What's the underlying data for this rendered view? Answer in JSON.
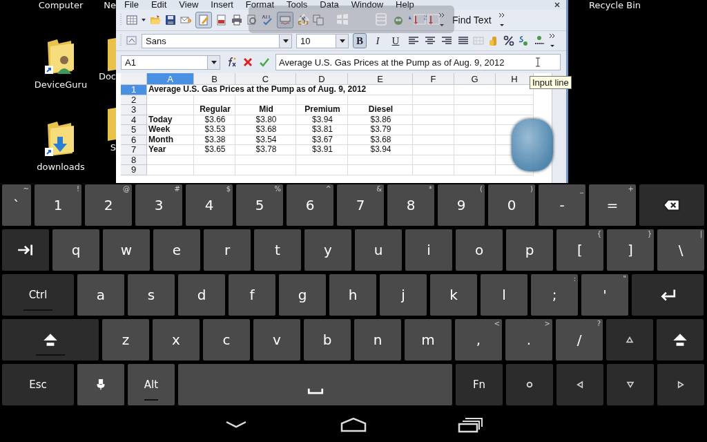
{
  "desktop": {
    "icons": [
      {
        "label": "Computer",
        "kind": "label"
      },
      {
        "label": "DeviceGuru",
        "kind": "folder"
      },
      {
        "label": "downloads",
        "kind": "folder"
      }
    ],
    "cut_icons": [
      {
        "label": "Ne",
        "kind": "label"
      },
      {
        "label": "Doc",
        "kind": "folder"
      },
      {
        "label": "S",
        "kind": "folder"
      }
    ],
    "recycle_bin": "Recycle Bin"
  },
  "spreadsheet": {
    "menu": [
      "File",
      "Edit",
      "View",
      "Insert",
      "Format",
      "Tools",
      "Data",
      "Window",
      "Help"
    ],
    "find_text": "Find Text",
    "font_name": "Sans",
    "font_size": "10",
    "format_buttons": [
      {
        "label": "B",
        "selected": true
      },
      {
        "label": "I",
        "selected": false
      },
      {
        "label": "U",
        "selected": false
      }
    ],
    "name_box": "A1",
    "input_line": "Average U.S. Gas Prices at the Pump as of Aug. 9, 2012",
    "tooltip": "Input line",
    "columns": [
      {
        "label": "A",
        "selected": true
      },
      {
        "label": "B",
        "selected": false
      },
      {
        "label": "C",
        "selected": false
      },
      {
        "label": "D",
        "selected": false
      },
      {
        "label": "E",
        "selected": false
      },
      {
        "label": "F",
        "selected": false
      },
      {
        "label": "G",
        "selected": false
      },
      {
        "label": "H",
        "selected": false
      }
    ],
    "rows": [
      {
        "number": "1",
        "selected": true,
        "kind": "title",
        "title": "Average U.S. Gas Prices at the Pump as of Aug. 9, 2012"
      },
      {
        "number": "2",
        "selected": false,
        "kind": "blank"
      },
      {
        "number": "3",
        "selected": false,
        "kind": "header",
        "values": [
          "Regular",
          "Mid",
          "Premium",
          "Diesel"
        ]
      },
      {
        "number": "4",
        "selected": false,
        "kind": "data",
        "label": "Today",
        "values": [
          "$3.66",
          "$3.80",
          "$3.94",
          "$3.86"
        ]
      },
      {
        "number": "5",
        "selected": false,
        "kind": "data",
        "label": "Week",
        "values": [
          "$3.53",
          "$3.68",
          "$3.81",
          "$3.79"
        ]
      },
      {
        "number": "6",
        "selected": false,
        "kind": "data",
        "label": "Month",
        "values": [
          "$3.38",
          "$3.54",
          "$3.67",
          "$3.68"
        ]
      },
      {
        "number": "7",
        "selected": false,
        "kind": "data",
        "label": "Year",
        "values": [
          "$3.65",
          "$3.78",
          "$3.91",
          "$3.94"
        ]
      },
      {
        "number": "8",
        "selected": false,
        "kind": "blank"
      },
      {
        "number": "9",
        "selected": false,
        "kind": "blank"
      }
    ]
  },
  "keyboard": {
    "rows": [
      {
        "keys": [
          {
            "kind": "char",
            "label": "`",
            "hint": "~"
          },
          {
            "kind": "char",
            "label": "1",
            "hint": "!"
          },
          {
            "kind": "char",
            "label": "2",
            "hint": "@"
          },
          {
            "kind": "char",
            "label": "3",
            "hint": "#"
          },
          {
            "kind": "char",
            "label": "4",
            "hint": "$"
          },
          {
            "kind": "char",
            "label": "5",
            "hint": "%"
          },
          {
            "kind": "char",
            "label": "6",
            "hint": "^"
          },
          {
            "kind": "char",
            "label": "7",
            "hint": "&"
          },
          {
            "kind": "char",
            "label": "8",
            "hint": "*"
          },
          {
            "kind": "char",
            "label": "9",
            "hint": "("
          },
          {
            "kind": "char",
            "label": "0",
            "hint": ")"
          },
          {
            "kind": "char",
            "label": "-",
            "hint": "_"
          },
          {
            "kind": "char",
            "label": "=",
            "hint": "+"
          },
          {
            "kind": "backspace"
          }
        ]
      },
      {
        "keys": [
          {
            "kind": "tab"
          },
          {
            "kind": "char",
            "label": "q"
          },
          {
            "kind": "char",
            "label": "w"
          },
          {
            "kind": "char",
            "label": "e"
          },
          {
            "kind": "char",
            "label": "r"
          },
          {
            "kind": "char",
            "label": "t"
          },
          {
            "kind": "char",
            "label": "y"
          },
          {
            "kind": "char",
            "label": "u"
          },
          {
            "kind": "char",
            "label": "i"
          },
          {
            "kind": "char",
            "label": "o"
          },
          {
            "kind": "char",
            "label": "p"
          },
          {
            "kind": "char",
            "label": "[",
            "hint": "{"
          },
          {
            "kind": "char",
            "label": "]",
            "hint": "}"
          },
          {
            "kind": "char",
            "label": "\\",
            "hint": "|"
          }
        ]
      },
      {
        "keys": [
          {
            "kind": "mod",
            "label": "Ctrl",
            "indicator": true
          },
          {
            "kind": "char",
            "label": "a"
          },
          {
            "kind": "char",
            "label": "s"
          },
          {
            "kind": "char",
            "label": "d"
          },
          {
            "kind": "char",
            "label": "f"
          },
          {
            "kind": "char",
            "label": "g"
          },
          {
            "kind": "char",
            "label": "h"
          },
          {
            "kind": "char",
            "label": "j"
          },
          {
            "kind": "char",
            "label": "k"
          },
          {
            "kind": "char",
            "label": "l"
          },
          {
            "kind": "char",
            "label": ";",
            "hint": ":"
          },
          {
            "kind": "char",
            "label": "'",
            "hint": "\""
          },
          {
            "kind": "enter"
          }
        ]
      },
      {
        "keys": [
          {
            "kind": "shift",
            "indicator": true
          },
          {
            "kind": "char",
            "label": "z"
          },
          {
            "kind": "char",
            "label": "x"
          },
          {
            "kind": "char",
            "label": "c"
          },
          {
            "kind": "char",
            "label": "v"
          },
          {
            "kind": "char",
            "label": "b"
          },
          {
            "kind": "char",
            "label": "n"
          },
          {
            "kind": "char",
            "label": "m"
          },
          {
            "kind": "char",
            "label": ",",
            "hint": "<"
          },
          {
            "kind": "char",
            "label": ".",
            "hint": ">"
          },
          {
            "kind": "char",
            "label": "/",
            "hint": "?"
          },
          {
            "kind": "up"
          },
          {
            "kind": "shift"
          }
        ]
      },
      {
        "keys": [
          {
            "kind": "mod",
            "label": "Esc"
          },
          {
            "kind": "mic"
          },
          {
            "kind": "word",
            "label": "Alt",
            "indicator": true
          },
          {
            "kind": "space"
          },
          {
            "kind": "mod",
            "label": "Fn"
          },
          {
            "kind": "circle"
          },
          {
            "kind": "left"
          },
          {
            "kind": "down"
          },
          {
            "kind": "right"
          }
        ]
      }
    ]
  }
}
